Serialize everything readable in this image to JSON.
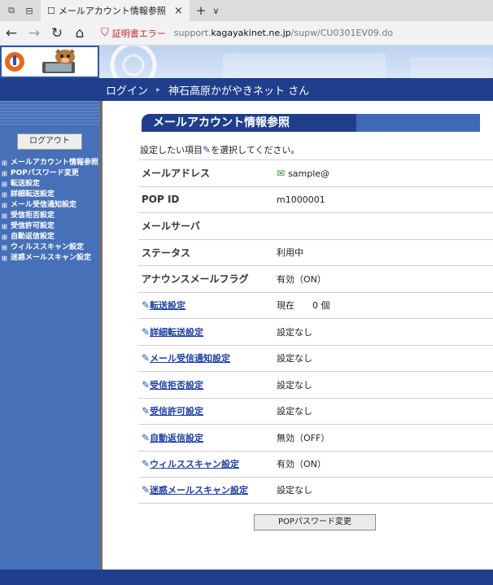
{
  "browser": {
    "tab_title": "メールアカウント情報参照",
    "tab_close": "×",
    "new_tab": "+",
    "tab_menu": "∨",
    "cert_error": "証明書エラー",
    "url_prefix": "support.",
    "url_host": "kagayakinet.ne.jp",
    "url_path": "/supw/CU0301EV09.do"
  },
  "header": {
    "login_label": "ログイン",
    "arrow": "▸",
    "user_name": "神石高原かがやきネット さん"
  },
  "sidebar": {
    "logout_label": "ログアウト",
    "items": [
      "メールアカウント情報参照",
      "POPパスワード変更",
      "転送設定",
      "詳細転送設定",
      "メール受信通知設定",
      "受信拒否設定",
      "受信許可設定",
      "自動返信設定",
      "ウィルススキャン設定",
      "迷惑メールスキャン設定"
    ]
  },
  "main": {
    "title": "メールアカウント情報参照",
    "instruction_before": "設定したい項目",
    "instruction_after": "を選択してください。",
    "rows": [
      {
        "label": "メールアドレス",
        "value": "sample@"
      },
      {
        "label": "POP ID",
        "value": "m1000001"
      },
      {
        "label": "メールサーバ",
        "value": ""
      },
      {
        "label": "ステータス",
        "value": "利用中"
      },
      {
        "label": "アナウンスメールフラグ",
        "value": "有効（ON）"
      },
      {
        "label": "転送設定",
        "value": "現在　　0 個"
      },
      {
        "label": "詳細転送設定",
        "value": "設定なし"
      },
      {
        "label": "メール受信通知設定",
        "value": "設定なし"
      },
      {
        "label": "受信拒否設定",
        "value": "設定なし"
      },
      {
        "label": "受信許可設定",
        "value": "設定なし"
      },
      {
        "label": "自動返信設定",
        "value": "無効（OFF）"
      },
      {
        "label": "ウィルススキャン設定",
        "value": "有効（ON）"
      },
      {
        "label": "迷惑メールスキャン設定",
        "value": "設定なし"
      }
    ],
    "pw_button": "POPパスワード変更"
  },
  "icons": {
    "pen": "pencil-icon",
    "mail": "envelope-icon",
    "sidebar_bullet": "plus-square-icon"
  },
  "colors": {
    "navy": "#1f3f8c",
    "sidebar_blue": "#4670b8",
    "link": "#1d3fa0",
    "cert_red": "#c4262e"
  }
}
